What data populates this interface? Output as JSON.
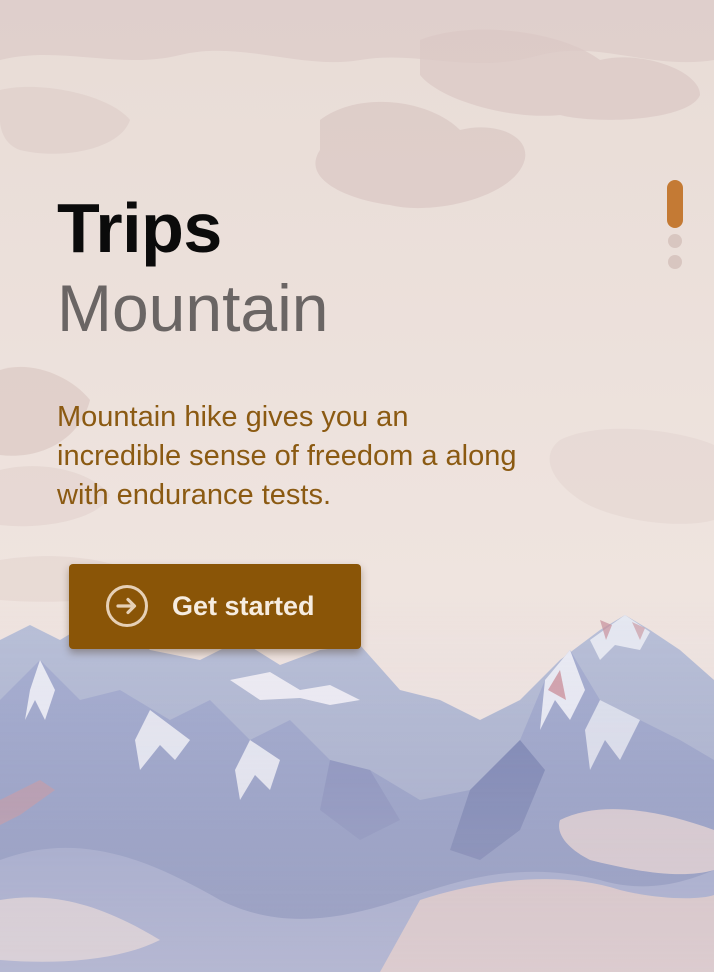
{
  "hero": {
    "title": "Trips",
    "subtitle": "Mountain",
    "description": "Mountain hike gives you an incredible sense of freedom a along with endurance tests."
  },
  "cta": {
    "label": "Get started",
    "icon": "arrow-right-circle-icon"
  },
  "pager": {
    "total": 3,
    "active_index": 0
  },
  "colors": {
    "accent": "#8a5507",
    "description_text": "#8b5a12",
    "active_dot": "#c47a34"
  }
}
